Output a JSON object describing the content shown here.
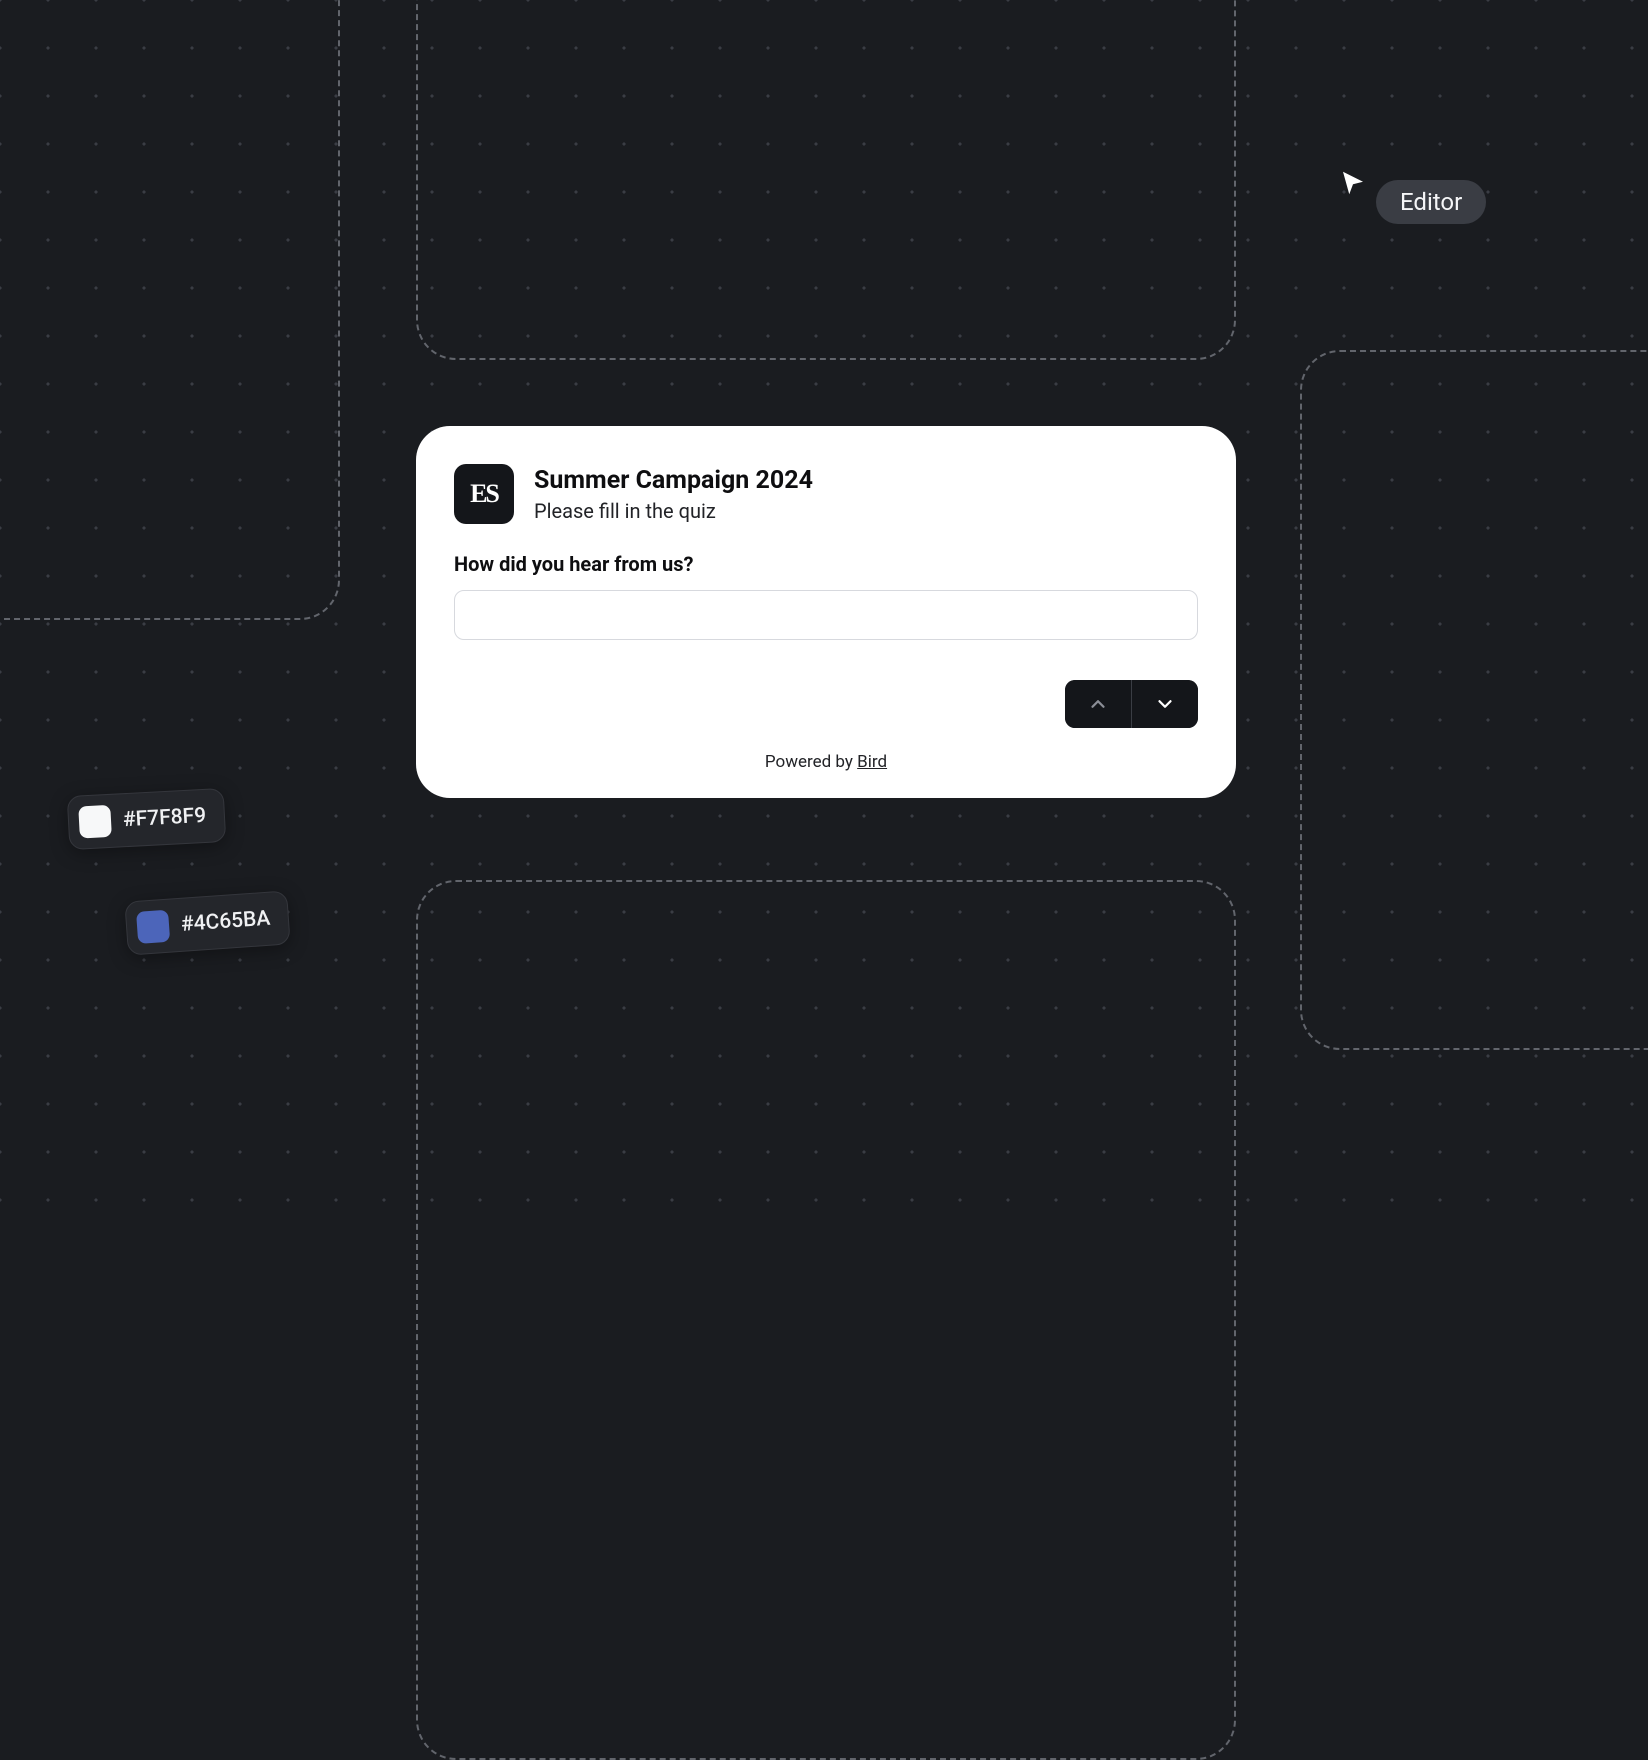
{
  "cursor": {
    "label": "Editor"
  },
  "card": {
    "logo_text": "ES",
    "title": "Summer Campaign 2024",
    "subtitle": "Please fill in the quiz",
    "question": "How did you hear from us?",
    "input_value": "",
    "footer_prefix": "Powered by ",
    "footer_brand": "Bird"
  },
  "swatches": [
    {
      "hex": "#F7F8F9"
    },
    {
      "hex": "#4C65BA"
    }
  ]
}
